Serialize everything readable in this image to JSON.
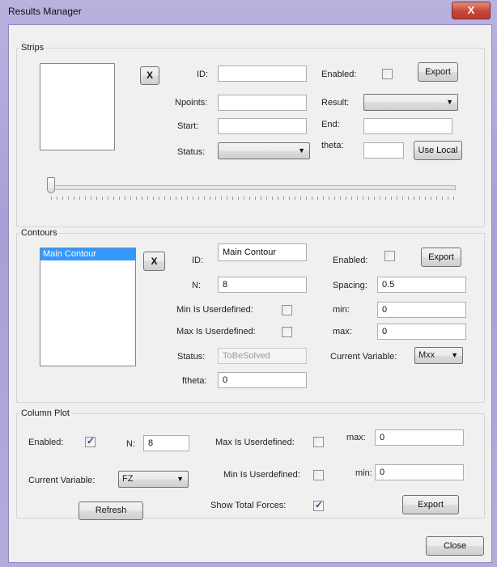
{
  "window": {
    "title": "Results Manager",
    "close_label": "X"
  },
  "strips": {
    "legend": "Strips",
    "remove_label": "X",
    "id_label": "ID:",
    "id_value": "",
    "enabled_label": "Enabled:",
    "enabled_checked": false,
    "export_label": "Export",
    "npoints_label": "Npoints:",
    "npoints_value": "",
    "result_label": "Result:",
    "result_value": "",
    "start_label": "Start:",
    "start_value": "",
    "end_label": "End:",
    "end_value": "",
    "status_label": "Status:",
    "status_value": "",
    "theta_label": "theta:",
    "theta_value": "",
    "use_local_label": "Use Local",
    "slider_value": 0
  },
  "contours": {
    "legend": "Contours",
    "list_items": [
      "Main Contour"
    ],
    "remove_label": "X",
    "id_label": "ID:",
    "id_value": "Main Contour",
    "enabled_label": "Enabled:",
    "enabled_checked": false,
    "export_label": "Export",
    "n_label": "N:",
    "n_value": "8",
    "spacing_label": "Spacing:",
    "spacing_value": "0.5",
    "min_user_label": "Min Is Userdefined:",
    "min_user_checked": false,
    "min_label": "min:",
    "min_value": "0",
    "max_user_label": "Max Is Userdefined:",
    "max_user_checked": false,
    "max_label": "max:",
    "max_value": "0",
    "status_label": "Status:",
    "status_value": "ToBeSolved",
    "current_variable_label": "Current Variable:",
    "current_variable_value": "Mxx",
    "ftheta_label": "ftheta:",
    "ftheta_value": "0"
  },
  "column_plot": {
    "legend": "Column Plot",
    "enabled_label": "Enabled:",
    "enabled_checked": true,
    "n_label": "N:",
    "n_value": "8",
    "max_user_label": "Max Is Userdefined:",
    "max_user_checked": false,
    "max_label": "max:",
    "max_value": "0",
    "current_variable_label": "Current Variable:",
    "current_variable_value": "FZ",
    "min_user_label": "Min Is Userdefined:",
    "min_user_checked": false,
    "min_label": "min:",
    "min_value": "0",
    "refresh_label": "Refresh",
    "show_total_label": "Show Total Forces:",
    "show_total_checked": true,
    "export_label": "Export"
  },
  "footer": {
    "close_label": "Close"
  },
  "icons": {
    "combo_arrow": "chevron-down-icon",
    "check": "checkmark-icon"
  }
}
